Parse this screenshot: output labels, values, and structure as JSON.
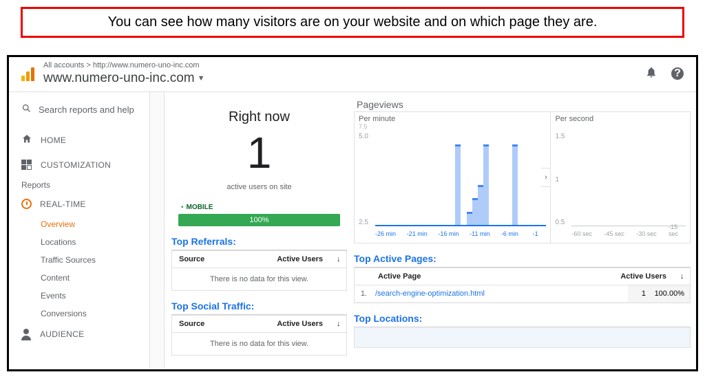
{
  "callout": "You can see how many visitors are on your website and on which page they are.",
  "header": {
    "crumb_accounts": "All accounts",
    "crumb_url": "http://www.numero-uno-inc.com",
    "site": "www.numero-uno-inc.com"
  },
  "sidebar": {
    "search_placeholder": "Search reports and help",
    "home": "HOME",
    "customization": "CUSTOMIZATION",
    "reports_label": "Reports",
    "realtime": "REAL-TIME",
    "overview": "Overview",
    "locations": "Locations",
    "traffic": "Traffic Sources",
    "content": "Content",
    "events": "Events",
    "conversions": "Conversions",
    "audience": "AUDIENCE"
  },
  "right_now": {
    "title": "Right now",
    "count": "1",
    "subtitle": "active users on site",
    "mobile_label": "MOBILE",
    "mobile_pct": "100%"
  },
  "pageviews": {
    "title": "Pageviews",
    "per_minute": "Per minute",
    "per_second": "Per second",
    "min_ymax": "7.5",
    "min_yticks": [
      "5.0",
      "2.5"
    ],
    "min_xticks": [
      "-26 min",
      "-21 min",
      "-16 min",
      "-11 min",
      "-6 min",
      "-1"
    ],
    "sec_yticks": [
      "1.5",
      "1",
      "0.5"
    ],
    "sec_xticks": [
      "-60 sec",
      "-45 sec",
      "-30 sec",
      "-15 sec"
    ]
  },
  "chart_data": {
    "type": "bar",
    "title": "Pageviews per minute",
    "xlabel": "minutes ago",
    "ylabel": "pageviews",
    "ylim": [
      0,
      7.5
    ],
    "series": [
      {
        "name": "Per minute",
        "x_minutes_ago": [
          16,
          14,
          13,
          12,
          11,
          6
        ],
        "values": [
          6,
          1,
          2,
          3,
          6,
          6
        ]
      }
    ],
    "per_second": {
      "ylim": [
        0,
        1.5
      ],
      "values": []
    }
  },
  "top_referrals": {
    "heading": "Top Referrals:",
    "col_source": "Source",
    "col_users": "Active Users",
    "empty": "There is no data for this view."
  },
  "top_social": {
    "heading": "Top Social Traffic:",
    "col_source": "Source",
    "col_users": "Active Users",
    "empty": "There is no data for this view."
  },
  "top_active_pages": {
    "heading": "Top Active Pages:",
    "col_page": "Active Page",
    "col_users": "Active Users",
    "rows": [
      {
        "idx": "1.",
        "page": "/search-engine-optimization.html",
        "users": "1",
        "pct": "100.00%"
      }
    ]
  },
  "top_locations": {
    "heading": "Top Locations:"
  }
}
